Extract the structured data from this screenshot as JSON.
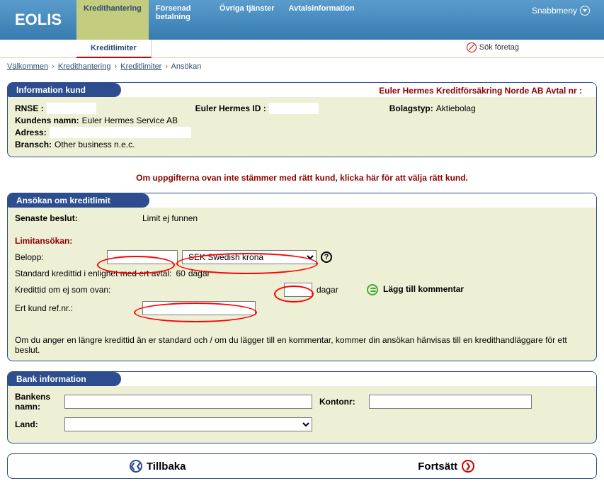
{
  "brand": "EOLIS",
  "topnav": {
    "items": [
      {
        "line1": "Kredithantering",
        "line2": ""
      },
      {
        "line1": "Försenad",
        "line2": "betalning"
      },
      {
        "line1": "Övriga tjänster",
        "line2": ""
      },
      {
        "line1": "Avtalsinformation",
        "line2": ""
      }
    ],
    "snabbmeny": "Snabbmeny"
  },
  "subtabs": {
    "items": [
      "Kreditlimiter"
    ],
    "search": "Sök företag"
  },
  "breadcrumb": {
    "items": [
      "Välkommen",
      "Kredithantering",
      "Kreditlimiter",
      "Ansökan"
    ]
  },
  "info_panel": {
    "title": "Information kund",
    "contract_line": "Euler Hermes Kreditförsäkring Norde AB Avtal nr :",
    "rnse_label": "RNSE :",
    "rnse_value": "",
    "ehid_label": "Euler Hermes ID :",
    "ehid_value": "",
    "company_type_label": "Bolagstyp:",
    "company_type_value": "Aktiebolag",
    "customer_name_label": "Kundens namn:",
    "customer_name_value": "Euler Hermes Service AB",
    "address_label": "Adress:",
    "address_value": "",
    "industry_label": "Bransch:",
    "industry_value": "Other business n.e.c."
  },
  "alert": {
    "prefix": "Om uppgifterna ovan inte stämmer med rätt kund, ",
    "link": "klicka här",
    "suffix": " för att välja rätt kund."
  },
  "apply_panel": {
    "title": "Ansökan om kreditlimit",
    "latest_decision_label": "Senaste beslut:",
    "latest_decision_value": "Limit ej funnen",
    "limit_app": "Limitansökan:",
    "amount_label": "Belopp:",
    "currency_value": "SEK Swedish krona",
    "std_credit_label": "Standard kredittid i enlighet med ert avtal:",
    "std_credit_value": "60",
    "days_unit": "dagar",
    "credit_if_not_label": "Kredittid om ej som ovan:",
    "your_ref_label": "Ert kund ref.nr.:",
    "add_comment": "Lägg till kommentar",
    "note": "Om du anger en längre kredittid än er standard och / om du lägger till en kommentar, kommer din ansökan hänvisas till en kredithandläggare för ett beslut."
  },
  "bank_panel": {
    "title": "Bank information",
    "bank_name_label": "Bankens namn:",
    "account_label": "Kontonr:",
    "country_label": "Land:"
  },
  "buttons": {
    "back": "Tillbaka",
    "continue": "Fortsätt"
  }
}
